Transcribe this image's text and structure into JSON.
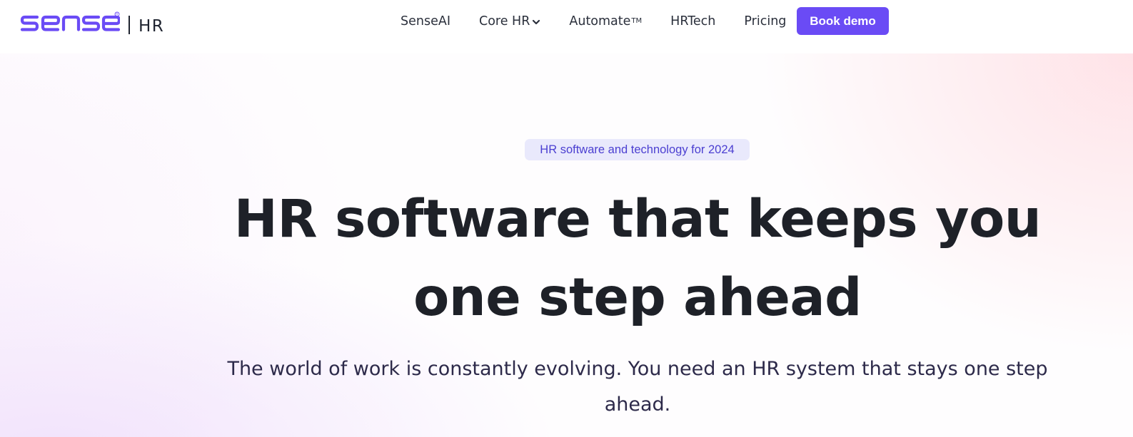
{
  "brand": {
    "logo_text": "sense",
    "product": "HR",
    "accent_color": "#6a4bf5",
    "icon": "sense-logo-icon"
  },
  "nav": {
    "items": [
      {
        "label": "SenseAI"
      },
      {
        "label": "Core HR",
        "icon": "chevron-down-icon"
      },
      {
        "label": "Automate",
        "suffix": "TM"
      },
      {
        "label": "HRTech"
      },
      {
        "label": "Pricing"
      }
    ],
    "cta_label": "Book demo"
  },
  "hero": {
    "badge": "HR software and technology for 2024",
    "headline_line1": "HR software that keeps you",
    "headline_line2": "one step ahead",
    "subtext": "The world of work is constantly evolving. You need an HR system that stays one step ahead."
  }
}
